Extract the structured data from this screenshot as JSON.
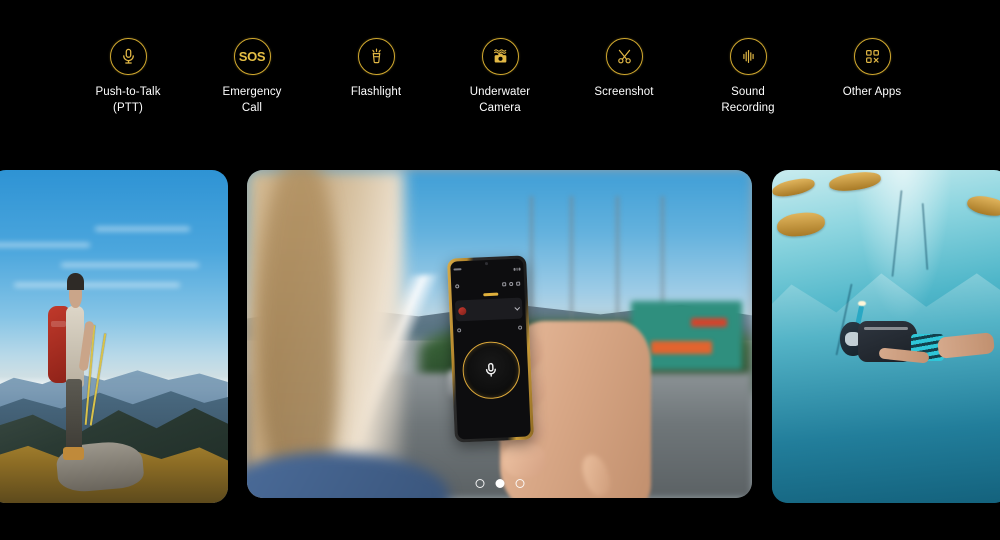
{
  "features": {
    "items": [
      {
        "icon": "microphone-icon",
        "label_line1": "Push-to-Talk",
        "label_line2": "(PTT)"
      },
      {
        "icon": "sos-icon",
        "label_line1": "Emergency",
        "label_line2": "Call",
        "glyph": "SOS"
      },
      {
        "icon": "flashlight-icon",
        "label_line1": "Flashlight",
        "label_line2": ""
      },
      {
        "icon": "underwater-camera-icon",
        "label_line1": "Underwater",
        "label_line2": "Camera"
      },
      {
        "icon": "scissors-icon",
        "label_line1": "Screenshot",
        "label_line2": ""
      },
      {
        "icon": "waveform-icon",
        "label_line1": "Sound",
        "label_line2": "Recording"
      },
      {
        "icon": "apps-grid-icon",
        "label_line1": "Other Apps",
        "label_line2": ""
      }
    ]
  },
  "carousel": {
    "slides": [
      {
        "name": "hiker-mountain-photo",
        "alt": "Hiker with red backpack standing on a mountain ridge overlooking valleys under a blue sky"
      },
      {
        "name": "ptt-phone-in-hand-photo",
        "alt": "Woman holding a rugged smartphone showing the Push-to-Talk app beside a highway"
      },
      {
        "name": "underwater-snorkeler-photo",
        "alt": "Snorkeler swimming underwater over turquoise rocks with fish"
      }
    ],
    "active_index": 1,
    "dot_count": 3
  },
  "phone_screen": {
    "app": "push-to-talk",
    "ptt_button_label": "",
    "mic_icon": "microphone-icon"
  },
  "colors": {
    "background": "#000000",
    "accent_gold": "#d4af37",
    "icon_ring": "#cfa72e",
    "label_text": "#fefefe",
    "dot_active": "#ffffff"
  }
}
